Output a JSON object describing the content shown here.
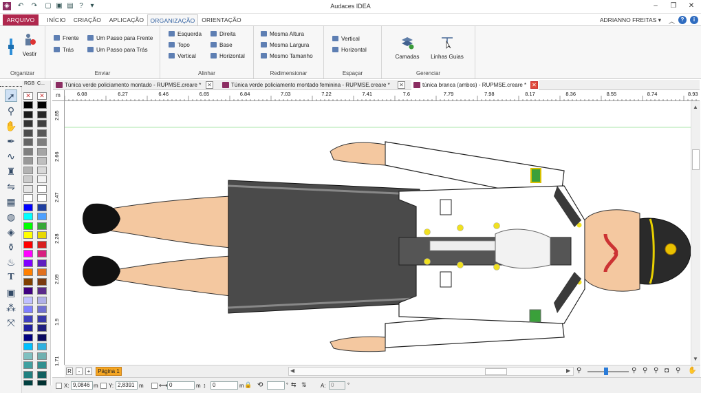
{
  "app": {
    "title": "Audaces IDEA"
  },
  "menu": {
    "tabs": [
      "ARQUIVO",
      "INÍCIO",
      "CRIAÇÃO",
      "APLICAÇÃO",
      "ORGANIZAÇÃO",
      "ORIENTAÇÃO"
    ],
    "user": "ADRIANNO FREITAS ▾"
  },
  "ribbon": {
    "organizar": {
      "label": "Organizar",
      "vestir": "Vestir"
    },
    "enviar": {
      "label": "Enviar",
      "frente": "Frente",
      "tras": "Trás",
      "passo_frente": "Um Passo para Frente",
      "passo_tras": "Um Passo para Trás"
    },
    "alinhar": {
      "label": "Alinhar",
      "esquerda": "Esquerda",
      "topo": "Topo",
      "vertical": "Vertical",
      "direita": "Direita",
      "base": "Base",
      "horizontal": "Horizontal"
    },
    "redimensionar": {
      "label": "Redimensionar",
      "mesma_altura": "Mesma Altura",
      "mesma_largura": "Mesma Largura",
      "mesmo_tamanho": "Mesmo Tamanho"
    },
    "espacar": {
      "label": "Espaçar",
      "vertical": "Vertical",
      "horizontal": "Horizontal"
    },
    "gerenciar": {
      "label": "Gerenciar",
      "camadas": "Camadas",
      "linhas_guias": "Linhas Guias"
    }
  },
  "palette": {
    "header_rgb": "RGB",
    "header_c": "C...",
    "colors_left": [
      "#000000",
      "#1a1a1a",
      "#333333",
      "#4d4d4d",
      "#666666",
      "#808080",
      "#999999",
      "#b3b3b3",
      "#cccccc",
      "#e6e6e6",
      "#ffffff",
      "#0000ff",
      "#00ffff",
      "#00ff00",
      "#ffff00",
      "#ff0000",
      "#ff00ff",
      "#8000ff",
      "#ff8000",
      "#804000",
      "#400080",
      "#c0c0ff",
      "#8080ff",
      "#4040c0",
      "#2020a0",
      "#000080",
      "#00c0ff",
      "#80c0c0",
      "#40a0a0",
      "#208080",
      "#004040"
    ],
    "colors_right": [
      "#000000",
      "#262626",
      "#3f3f3f",
      "#595959",
      "#7f7f7f",
      "#a5a5a5",
      "#bfbfbf",
      "#d8d8d8",
      "#f2f2f2",
      "#ffffff",
      "#ffffff",
      "#1f3f9f",
      "#4ea0ff",
      "#38a838",
      "#e8d800",
      "#d82020",
      "#d82080",
      "#6020c0",
      "#e07020",
      "#7a3a10",
      "#5a2a8a",
      "#b0b0e8",
      "#7070d0",
      "#3838a8",
      "#202080",
      "#0a0a60",
      "#30b0e0",
      "#70b0b0",
      "#309090",
      "#106060",
      "#003030"
    ]
  },
  "doc_tabs": [
    "Túnica verde policiamento montado - RUPMSE.creare *",
    "Túnica verde policiamento montado feminina - RUPMSE.creare *",
    "túnica branca (ambos) - RUPMSE.creare *"
  ],
  "ruler": {
    "unit": "m",
    "h_ticks": [
      "6.08",
      "6.27",
      "6.46",
      "6.65",
      "6.84",
      "7.03",
      "7.22",
      "7.41",
      "7.6",
      "7.79",
      "7.98",
      "8.17",
      "8.36",
      "8.55",
      "8.74",
      "8.93"
    ],
    "v_ticks": [
      "2.85",
      "2.66",
      "2.47",
      "2.28",
      "2.09",
      "1.9",
      "1.71"
    ]
  },
  "pages": {
    "r": "R",
    "minus": "-",
    "plus": "+",
    "current": "Página 1"
  },
  "status": {
    "x_label": "X:",
    "x_value": "9,0846",
    "x_unit": "m",
    "y_label": "Y:",
    "y_value": "2,8391",
    "y_unit": "m",
    "w_value": "0",
    "w_unit": "m",
    "h_value": "0",
    "h_unit": "m",
    "deg": "°",
    "a_label": "A:",
    "a_value": "0",
    "a_unit": "°"
  },
  "zoom": {
    "slider_level": 0.45
  }
}
